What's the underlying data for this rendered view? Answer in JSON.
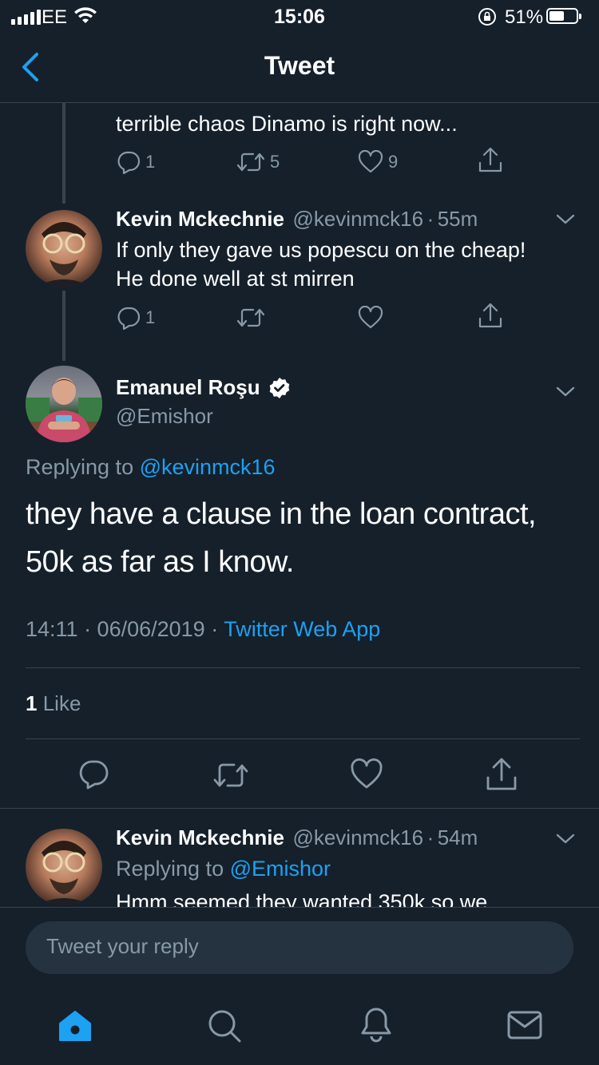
{
  "status_bar": {
    "carrier": "EE",
    "time": "15:06",
    "battery_percent": "51%",
    "battery_level": 0.51
  },
  "nav": {
    "title": "Tweet"
  },
  "prev_tweet": {
    "text_tail": "terrible chaos Dinamo is right now...",
    "replies": "1",
    "retweets": "5",
    "likes": "9"
  },
  "reply_tweet_1": {
    "name": "Kevin Mckechnie",
    "handle": "@kevinmck16",
    "dot": "·",
    "time": "55m",
    "text_line1": "If only they gave us popescu on the cheap!",
    "text_line2": "He done well at st mirren",
    "replies": "1"
  },
  "main_tweet": {
    "name": "Emanuel Roşu",
    "handle": "@Emishor",
    "replying_prefix": "Replying to",
    "replying_to": "@kevinmck16",
    "text_line1": "they have a clause in the loan contract,",
    "text_line2": "50k as far as I know.",
    "timestamp": "14:11 · 06/06/2019 ·",
    "source": "Twitter Web App",
    "like_count": "1",
    "like_label": "Like"
  },
  "reply_tweet_2": {
    "name": "Kevin Mckechnie",
    "handle": "@kevinmck16",
    "dot": "·",
    "time": "54m",
    "replying_prefix": "Replying to",
    "replying_to": "@Emishor",
    "text_partial": "Hmm seemed they wanted 350k so we"
  },
  "composer": {
    "placeholder": "Tweet your reply"
  },
  "tab_bar": {
    "items": [
      "home-icon",
      "search-icon",
      "notifications-icon",
      "messages-icon"
    ]
  },
  "colors": {
    "background": "#15202b",
    "accent": "#1da1f2",
    "muted": "#8899a6",
    "divider": "#38444d"
  }
}
